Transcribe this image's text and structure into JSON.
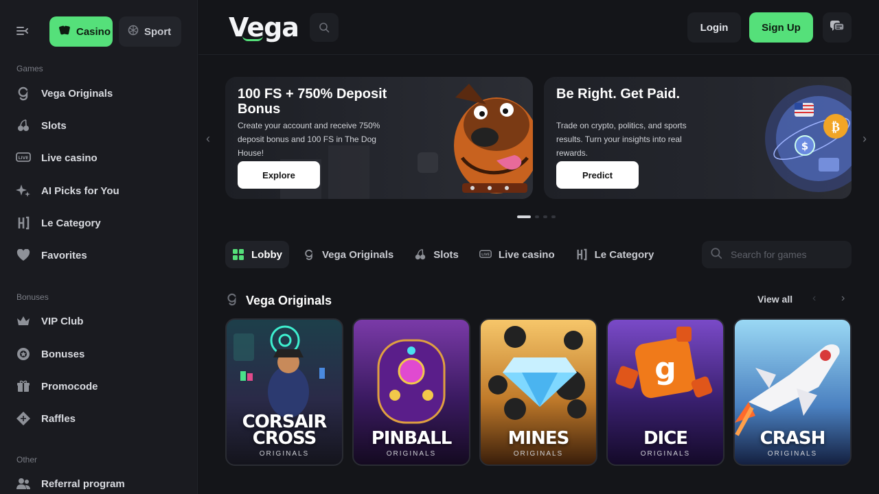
{
  "sidebar": {
    "modes": [
      {
        "label": "Casino"
      },
      {
        "label": "Sport"
      }
    ],
    "sections": {
      "games": "Games",
      "bonuses": "Bonuses",
      "other": "Other"
    },
    "games": [
      {
        "label": "Vega Originals",
        "icon": "vega-g-icon"
      },
      {
        "label": "Slots",
        "icon": "cherry-icon"
      },
      {
        "label": "Live casino",
        "icon": "live-icon"
      },
      {
        "label": "AI Picks for You",
        "icon": "sparkle-icon"
      },
      {
        "label": "Le Category",
        "icon": "le-category-icon"
      },
      {
        "label": "Favorites",
        "icon": "heart-icon"
      }
    ],
    "bonuses": [
      {
        "label": "VIP Club",
        "icon": "crown-icon"
      },
      {
        "label": "Bonuses",
        "icon": "coin-icon"
      },
      {
        "label": "Promocode",
        "icon": "gift-icon"
      },
      {
        "label": "Raffles",
        "icon": "ticket-icon"
      }
    ],
    "other": [
      {
        "label": "Referral program",
        "icon": "users-icon"
      }
    ]
  },
  "header": {
    "logo": "Vega",
    "login_label": "Login",
    "signup_label": "Sign Up"
  },
  "banners": [
    {
      "title": "100 FS + 750% Deposit Bonus",
      "text": "Create your account and receive 750% deposit bonus and 100 FS in The Dog House!",
      "button": "Explore"
    },
    {
      "title": "Be Right. Get Paid.",
      "text": "Trade on crypto, politics, and sports results. Turn your insights into real rewards.",
      "button": "Predict"
    }
  ],
  "tabs": [
    {
      "label": "Lobby",
      "icon": "grid-icon"
    },
    {
      "label": "Vega Originals",
      "icon": "vega-g-icon"
    },
    {
      "label": "Slots",
      "icon": "cherry-icon"
    },
    {
      "label": "Live casino",
      "icon": "live-icon"
    },
    {
      "label": "Le Category",
      "icon": "le-category-icon"
    }
  ],
  "search": {
    "placeholder": "Search for games"
  },
  "section": {
    "title": "Vega Originals",
    "view_all": "View all"
  },
  "games": [
    {
      "name": "CORSAIR CROSS",
      "sub": "ORIGINALS",
      "colors": [
        "#1d3f4a",
        "#3a2a5a"
      ]
    },
    {
      "name": "PINBALL",
      "sub": "ORIGINALS",
      "colors": [
        "#5a2a8a",
        "#2a1240"
      ]
    },
    {
      "name": "MINES",
      "sub": "ORIGINALS",
      "colors": [
        "#f2b24a",
        "#8a4a1a"
      ]
    },
    {
      "name": "DICE",
      "sub": "ORIGINALS",
      "colors": [
        "#6a3aa8",
        "#2a1a5a"
      ]
    },
    {
      "name": "CRASH",
      "sub": "ORIGINALS",
      "colors": [
        "#8fd0ef",
        "#3a6aa0"
      ]
    }
  ]
}
